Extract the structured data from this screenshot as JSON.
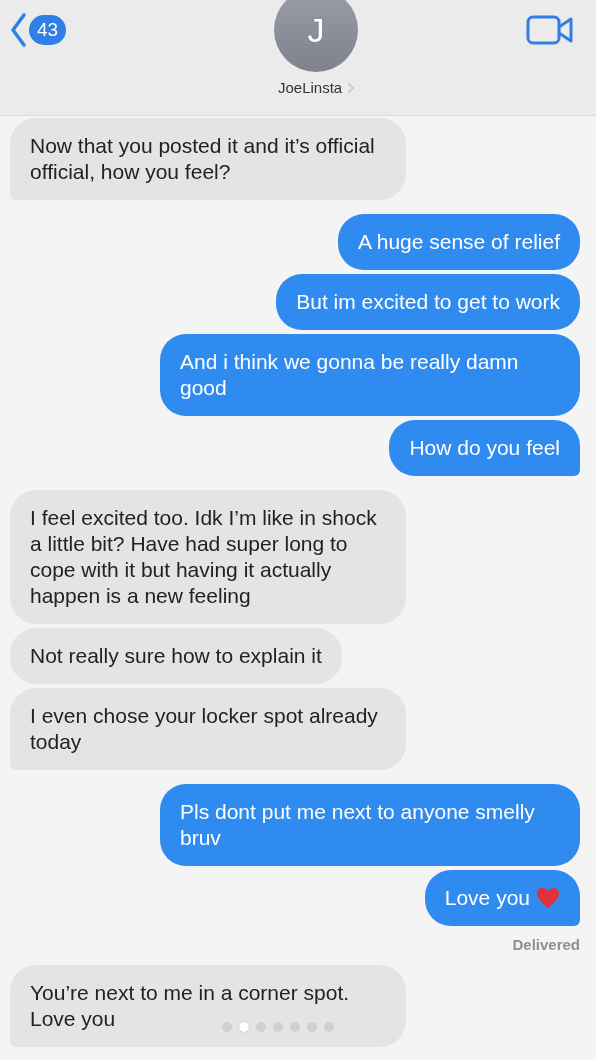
{
  "header": {
    "back_count": "43",
    "avatar_initial": "J",
    "contact_name": "JoeLinsta"
  },
  "messages": [
    {
      "kind": "received",
      "text": "Now that you posted it and it’s official official, how you feel?"
    },
    {
      "kind": "sent",
      "text": "A huge sense of relief"
    },
    {
      "kind": "sent",
      "text": "But im excited to get to work"
    },
    {
      "kind": "sent",
      "text": "And i think we gonna be really damn good"
    },
    {
      "kind": "sent",
      "text": "How do you feel"
    },
    {
      "kind": "received",
      "text": "I feel excited too. Idk I’m like in shock a little bit? Have had super long to cope with it but having it actually happen is a new feeling"
    },
    {
      "kind": "received",
      "text": "Not really sure how to explain it"
    },
    {
      "kind": "received",
      "text": "I even chose your locker spot already today"
    },
    {
      "kind": "sent",
      "text": "Pls dont put me next to anyone smelly bruv"
    },
    {
      "kind": "sent",
      "text": "Love you",
      "heart": true,
      "status": "Delivered"
    },
    {
      "kind": "received",
      "text": "You’re next to me in a corner spot. Love you"
    }
  ],
  "page_dots": [
    {
      "selected": false
    },
    {
      "selected": true
    },
    {
      "selected": false
    },
    {
      "selected": false
    },
    {
      "selected": false
    },
    {
      "selected": false
    },
    {
      "selected": false
    }
  ]
}
